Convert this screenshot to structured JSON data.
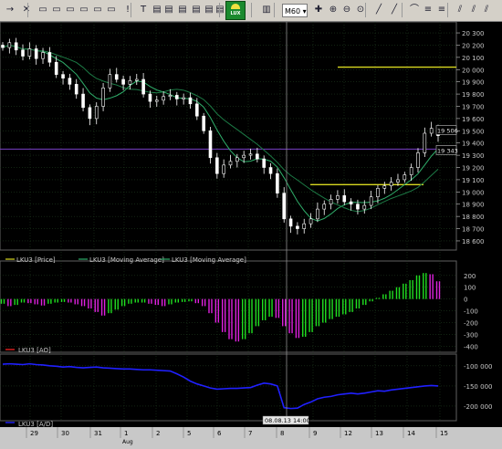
{
  "toolbar": {
    "timeframe": "M60",
    "logo_text": "LUX",
    "icons": [
      "arrow-icon",
      "cross-cursor-icon",
      "window-icon",
      "window-icon",
      "window-icon",
      "window-icon",
      "window-icon",
      "window-icon",
      "info-icon",
      "text-icon",
      "layers-icon",
      "layers-icon",
      "layers-icon",
      "layers-icon",
      "layers-icon",
      "layers-icon",
      "chart-type-icon",
      "crosshair-icon",
      "zoom-in-icon",
      "zoom-out-icon",
      "autoscroll-icon",
      "line-icon",
      "line-icon",
      "arc-icon",
      "fibo-icon",
      "fibo-icon",
      "gann-icon",
      "gann-icon",
      "gann-icon"
    ]
  },
  "colors": {
    "background": "#000000",
    "grid": "#1e3a1e",
    "axis_text": "#c8c8c8",
    "candles": "#ffffff",
    "ma_fast": "#2fae6a",
    "ma_slow": "#1c7a45",
    "resistance": "#d8d820",
    "horizontal_line": "#7a40c8",
    "osc_pos": "#e020e0",
    "osc_neg": "#20e020",
    "ad_line": "#2020ff",
    "crosshair": "#909090"
  },
  "chart_data": [
    {
      "type": "candlestick",
      "panel": "price",
      "ylim": [
        18540,
        20360
      ],
      "yticks": [
        20300,
        20200,
        20100,
        20000,
        19900,
        19800,
        19700,
        19600,
        19500,
        19400,
        19300,
        19200,
        19100,
        19000,
        18900,
        18800,
        18700,
        18600
      ],
      "y_tick_labels": [
        "20 300",
        "20 200",
        "20 100",
        "20 000",
        "19 900",
        "19 800",
        "19 700",
        "19 600",
        "19 500",
        "19 400",
        "19 300",
        "19 200",
        "19 100",
        "19 000",
        "18 900",
        "18 800",
        "18 700",
        "18 600"
      ],
      "price_tags": [
        {
          "label": "19 506",
          "value": 19506
        },
        {
          "label": "19 343",
          "value": 19343
        }
      ],
      "series_close": [
        20180,
        20220,
        20160,
        20110,
        20170,
        20090,
        20140,
        20060,
        19960,
        19930,
        19880,
        19800,
        19690,
        19600,
        19700,
        19850,
        19960,
        19920,
        19880,
        19910,
        19920,
        19800,
        19740,
        19750,
        19780,
        19790,
        19760,
        19770,
        19720,
        19620,
        19500,
        19280,
        19150,
        19220,
        19250,
        19280,
        19300,
        19310,
        19270,
        19200,
        19150,
        18990,
        18780,
        18720,
        18700,
        18740,
        18780,
        18860,
        18900,
        18940,
        18970,
        18920,
        18900,
        18860,
        18890,
        18960,
        19030,
        19050,
        19080,
        19100,
        19140,
        19200,
        19320,
        19480,
        19520,
        19460
      ],
      "legend": [
        "LKU3 [Price]",
        "LKU3 [Moving Average]",
        "LKU3 [Moving Average]"
      ],
      "resistance_levels": [
        20020,
        19060
      ],
      "horizontal_line": 19350
    },
    {
      "type": "histogram",
      "panel": "AO",
      "legend": [
        "LKU3 [AO]"
      ],
      "ylim": [
        -420,
        260
      ],
      "yticks": [
        200,
        100,
        0,
        -100,
        -200,
        -300,
        -400
      ],
      "y_tick_labels": [
        "200",
        "100",
        "0",
        "-100",
        "-200",
        "-300",
        "-400"
      ],
      "values": [
        -40,
        -60,
        -50,
        -30,
        -35,
        -45,
        -55,
        -40,
        -30,
        -25,
        -30,
        -45,
        -60,
        -80,
        -110,
        -140,
        -120,
        -90,
        -60,
        -40,
        -30,
        -30,
        -40,
        -50,
        -60,
        -45,
        -30,
        -25,
        -20,
        -35,
        -60,
        -120,
        -200,
        -280,
        -340,
        -360,
        -340,
        -290,
        -230,
        -180,
        -150,
        -160,
        -230,
        -290,
        -330,
        -320,
        -280,
        -230,
        -200,
        -170,
        -150,
        -130,
        -110,
        -80,
        -50,
        -20,
        10,
        40,
        70,
        100,
        130,
        160,
        200,
        220,
        210,
        150
      ]
    },
    {
      "type": "line",
      "panel": "A/D",
      "legend": [
        "LKU3 [A/D]"
      ],
      "ylim": [
        -225000,
        -80000
      ],
      "yticks": [
        -100000,
        -150000,
        -200000
      ],
      "y_tick_labels": [
        "-100 000",
        "-150 000",
        "-200 000"
      ],
      "values": [
        -96000,
        -95000,
        -96000,
        -97000,
        -95000,
        -97000,
        -98000,
        -100000,
        -101000,
        -103000,
        -102000,
        -104000,
        -105000,
        -104000,
        -103000,
        -105000,
        -106000,
        -107000,
        -108000,
        -108000,
        -109000,
        -110000,
        -110000,
        -111000,
        -112000,
        -113000,
        -120000,
        -128000,
        -138000,
        -145000,
        -150000,
        -155000,
        -158000,
        -157000,
        -156000,
        -156000,
        -155000,
        -154000,
        -148000,
        -143000,
        -145000,
        -150000,
        -204000,
        -206000,
        -205000,
        -196000,
        -190000,
        -182000,
        -178000,
        -176000,
        -172000,
        -170000,
        -168000,
        -170000,
        -168000,
        -165000,
        -162000,
        -163000,
        -160000,
        -158000,
        -156000,
        -154000,
        -152000,
        -150000,
        -149000,
        -150000
      ]
    }
  ],
  "x_axis": {
    "date_labels": [
      "29",
      "30",
      "31",
      "1",
      "2",
      "5",
      "6",
      "7",
      "8",
      "9",
      "12",
      "13",
      "14",
      "15"
    ],
    "month_label": "Aug",
    "cursor_label": "08.08.13 14:00"
  }
}
